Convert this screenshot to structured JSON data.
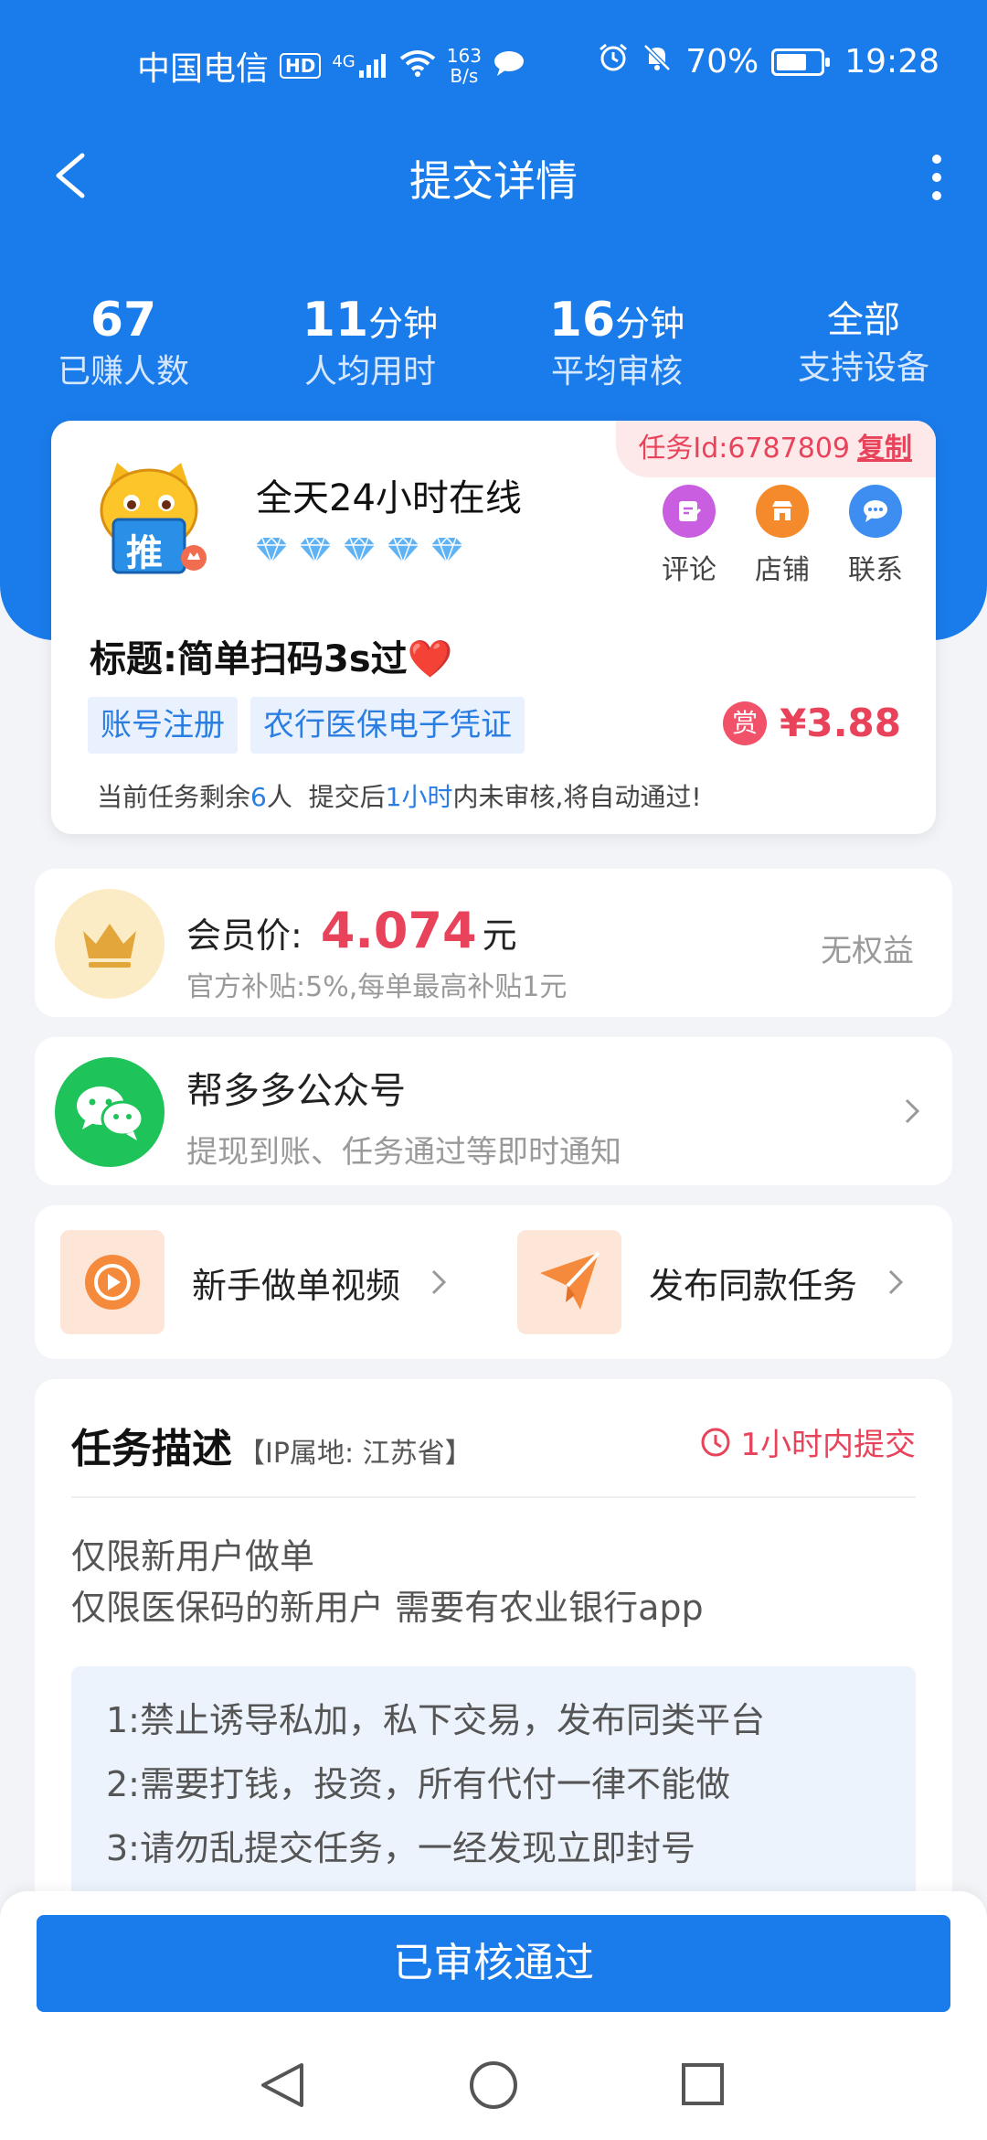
{
  "status_bar": {
    "carrier": "中国电信",
    "hd": "HD",
    "network": "4G",
    "speed_value": "163",
    "speed_unit": "B/s",
    "battery": "70%",
    "battery_level": 0.7,
    "time": "19:28"
  },
  "nav": {
    "title": "提交详情"
  },
  "stats": [
    {
      "value": "67",
      "unit": "",
      "label": "已赚人数"
    },
    {
      "value": "11",
      "unit": "分钟",
      "label": "人均用时"
    },
    {
      "value": "16",
      "unit": "分钟",
      "label": "平均审核"
    },
    {
      "value": "全部",
      "unit": "",
      "label": "支持设备"
    }
  ],
  "task": {
    "id_text": "任务Id:6787809",
    "copy_label": "复制",
    "avatar_text": "推",
    "shop_name": "全天24小时在线",
    "diamond_count": 5,
    "actions": [
      {
        "label": "评论",
        "color": "#c95ee0"
      },
      {
        "label": "店铺",
        "color": "#f58a2c"
      },
      {
        "label": "联系",
        "color": "#3d8ef0"
      }
    ],
    "title": "标题:简单扫码3s过",
    "heart": "❤️",
    "tags": [
      "账号注册",
      "农行医保电子凭证"
    ],
    "reward_badge": "赏",
    "price": "¥3.88",
    "notice": {
      "p1": "当前任务剩余",
      "remaining": "6",
      "p2": "人  提交后",
      "time": "1小时",
      "p3": "内未审核,将自动通过!"
    }
  },
  "member": {
    "label": "会员价:",
    "price": "4.074",
    "unit": "元",
    "sub": "官方补贴:5%,每单最高补贴1元",
    "benefit": "无权益"
  },
  "wechat": {
    "title": "帮多多公众号",
    "sub": "提现到账、任务通过等即时通知"
  },
  "quick_links": {
    "video_label": "新手做单视频",
    "publish_label": "发布同款任务"
  },
  "description": {
    "title": "任务描述",
    "ip": "【IP属地: 江苏省】",
    "deadline": "1小时内提交",
    "lines": [
      "仅限新用户做单",
      "仅限医保码的新用户 需要有农业银行app"
    ],
    "rules": [
      "1:禁止诱导私加，私下交易，发布同类平台",
      "2:需要打钱，投资，所有代付一律不能做",
      "3:请勿乱提交任务，一经发现立即封号"
    ]
  },
  "bottom": {
    "button_label": "已审核通过"
  },
  "colors": {
    "primary": "#1a7bea",
    "accent": "#e8435a",
    "wechat": "#1ec35a"
  }
}
